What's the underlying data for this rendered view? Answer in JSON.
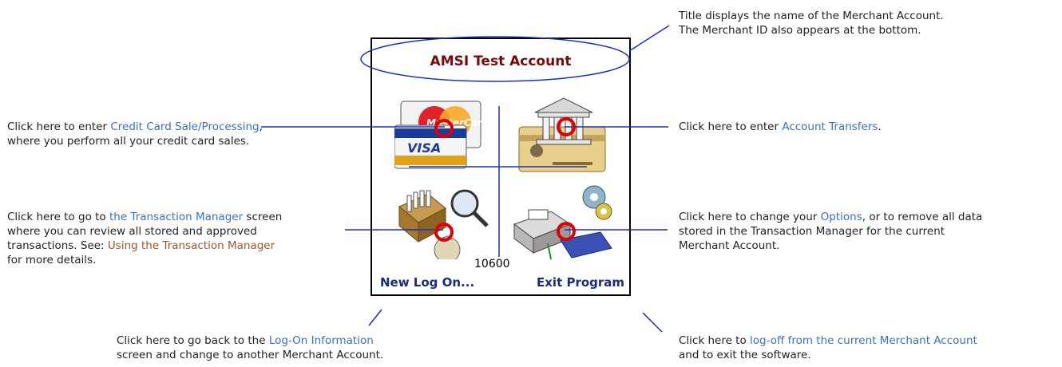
{
  "device": {
    "title": "AMSI Test Account",
    "merchant_id": "10600",
    "new_logon": "New Log On...",
    "exit_program": "Exit Program",
    "card_logos": {
      "mastercard": "MasterCard",
      "visa": "VISA"
    }
  },
  "annotations": {
    "title_note": {
      "line1": "Title displays the name of the Merchant Account.",
      "line2": "The Merchant ID also appears at the bottom."
    },
    "credit": {
      "pre": "Click here to enter ",
      "link": "Credit Card Sale/Processing",
      "post": ",",
      "line2": "where you perform all your credit card sales."
    },
    "transfers": {
      "pre": "Click here to enter ",
      "link": "Account Transfers",
      "post": "."
    },
    "transaction": {
      "pre": "Click here to go to ",
      "link": "the Transaction Manager",
      "post": " screen",
      "line2": "where you can review all stored and approved",
      "line3_pre": "transactions. See: ",
      "line3_link": "Using the Transaction Manager",
      "line4": "for more details."
    },
    "options": {
      "pre": "Click here to change your ",
      "link": "Options",
      "post": ", or to remove all data",
      "line2": "stored in the Transaction Manager for the current",
      "line3": "Merchant Account."
    },
    "logon": {
      "pre": "Click here to go back to the ",
      "link": "Log-On Information",
      "line2": "screen and change to another Merchant Account."
    },
    "logoff": {
      "pre": "Click here to ",
      "link": "log-off from the current Merchant Account",
      "line2": "and to exit the software."
    }
  },
  "colors": {
    "link": "#3b6fc7",
    "link_alt": "#a4532b",
    "title": "#7a0a0a",
    "button": "#1a2d7c",
    "guide": "#1a2ecc",
    "marker": "#e00000"
  }
}
